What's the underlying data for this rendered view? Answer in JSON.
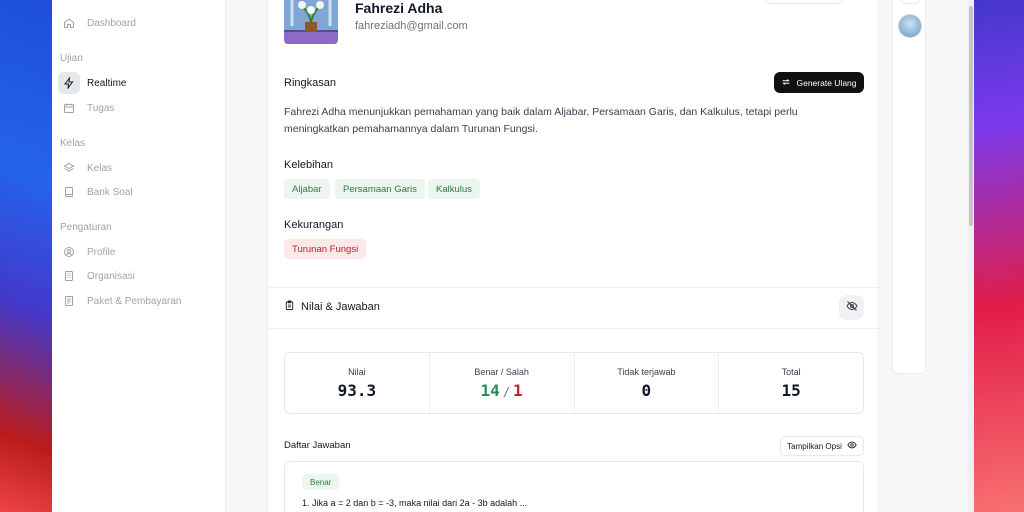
{
  "sidebar": {
    "items_top": [
      {
        "label": "Dashboard",
        "icon": "home-icon"
      }
    ],
    "groups": [
      {
        "title": "Ujian",
        "items": [
          {
            "label": "Realtime",
            "icon": "bolt-icon",
            "active": true
          },
          {
            "label": "Tugas",
            "icon": "calendar-icon"
          }
        ]
      },
      {
        "title": "Kelas",
        "items": [
          {
            "label": "Kelas",
            "icon": "layers-icon"
          },
          {
            "label": "Bank Soal",
            "icon": "book-icon"
          }
        ]
      },
      {
        "title": "Pengaturan",
        "items": [
          {
            "label": "Profile",
            "icon": "user-circle-icon"
          },
          {
            "label": "Organisasi",
            "icon": "building-icon"
          },
          {
            "label": "Paket & Pembayaran",
            "icon": "receipt-icon"
          }
        ]
      }
    ]
  },
  "student": {
    "name": "Fahrezi Adha",
    "email": "fahreziadh@gmail.com"
  },
  "summary": {
    "title": "Ringkasan",
    "regenerate_label": "Generate Ulang",
    "text": "Fahrezi Adha menunjukkan pemahaman yang baik dalam Aljabar, Persamaan Garis, dan Kalkulus, tetapi perlu meningkatkan pemahamannya dalam Turunan Fungsi."
  },
  "strengths": {
    "title": "Kelebihan",
    "items": [
      "Aljabar",
      "Persamaan Garis",
      "Kalkulus"
    ]
  },
  "weaknesses": {
    "title": "Kekurangan",
    "items": [
      "Turunan Fungsi"
    ]
  },
  "grades": {
    "title": "Nilai & Jawaban",
    "stats": {
      "score_label": "Nilai",
      "score_value": "93.3",
      "correct_wrong_label": "Benar / Salah",
      "correct": "14",
      "separator": "/",
      "wrong": "1",
      "unanswered_label": "Tidak terjawab",
      "unanswered_value": "0",
      "total_label": "Total",
      "total_value": "15"
    }
  },
  "answers": {
    "title": "Daftar Jawaban",
    "show_options_label": "Tampilkan Opsi",
    "items": [
      {
        "status": "Benar",
        "question": "1. Jika a = 2 dan b = -3, maka nilai dari 2a - 3b adalah ..."
      }
    ]
  },
  "colors": {
    "accent_green": "#2f8a55",
    "accent_red": "#c0262d",
    "primary_button": "#111111"
  }
}
